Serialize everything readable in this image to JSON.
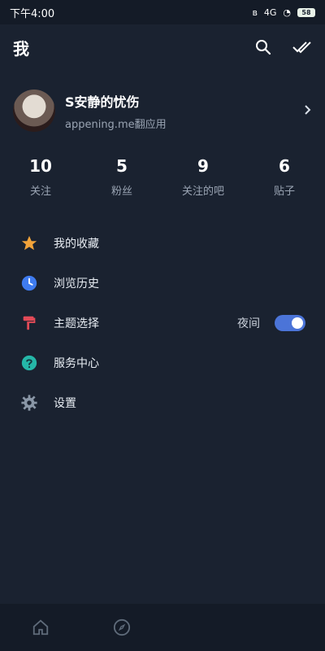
{
  "status": {
    "time": "下午4:00",
    "network": "4G",
    "battery": "58"
  },
  "header": {
    "title": "我"
  },
  "profile": {
    "name": "S安静的忧伤",
    "subtitle": "appening.me翻应用"
  },
  "stats": [
    {
      "value": "10",
      "label": "关注"
    },
    {
      "value": "5",
      "label": "粉丝"
    },
    {
      "value": "9",
      "label": "关注的吧"
    },
    {
      "value": "6",
      "label": "贴子"
    }
  ],
  "menu": [
    {
      "label": "我的收藏",
      "icon": "star-icon",
      "color": "#f2a33a"
    },
    {
      "label": "浏览历史",
      "icon": "clock-icon",
      "color": "#3f7cf0"
    },
    {
      "label": "主题选择",
      "icon": "paint-roller-icon",
      "color": "#e24a57",
      "value": "夜间"
    },
    {
      "label": "服务中心",
      "icon": "help-circle-icon",
      "color": "#25b7a8"
    },
    {
      "label": "设置",
      "icon": "gear-icon",
      "color": "#8a97a7"
    }
  ],
  "bottom_nav": [
    {
      "name": "home",
      "icon": "home-icon"
    },
    {
      "name": "discover",
      "icon": "compass-icon"
    }
  ]
}
